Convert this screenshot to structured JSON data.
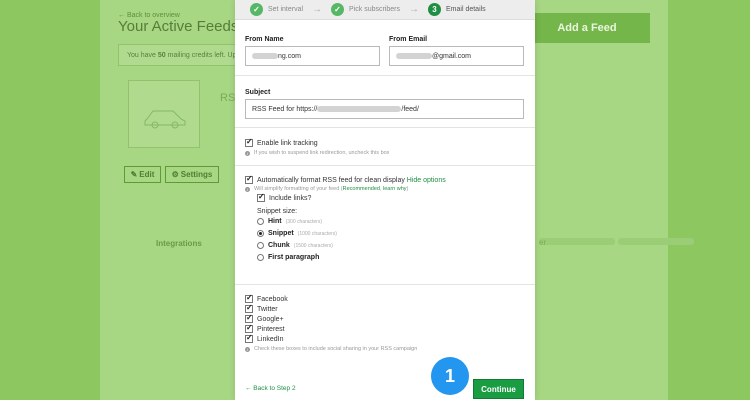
{
  "background": {
    "back_link": "← Back to overview",
    "title": "Your Active Feeds",
    "credits_prefix": "You have ",
    "credits_count": "50",
    "credits_suffix": " mailing credits left. Up",
    "add_feed": "Add a Feed",
    "feed_title_fragment": "RS",
    "edit_label": "Edit",
    "settings_label": "Settings",
    "integrations_label": "Integrations",
    "right_label_fragment": "er"
  },
  "steps": [
    {
      "icon": "✓",
      "label": "Set interval"
    },
    {
      "icon": "✓",
      "label": "Pick subscribers"
    },
    {
      "icon": "3",
      "label": "Email details"
    }
  ],
  "form": {
    "from_name_label": "From Name",
    "from_name_value": "ng.com",
    "from_email_label": "From Email",
    "from_email_value": "@gmail.com",
    "subject_label": "Subject",
    "subject_prefix": "RSS Feed for https://",
    "subject_suffix": "/feed/"
  },
  "link_tracking": {
    "label": "Enable link tracking",
    "hint": "If you wish to suspend link redirection, uncheck this box",
    "checked": true
  },
  "format": {
    "label": "Automatically format RSS feed for clean display ",
    "hide_options": "Hide options",
    "hint_prefix": "Will simplify formatting of your feed (",
    "recommended": "Recommended",
    "sep": ", ",
    "learn_why": "learn why",
    "hint_suffix": ")",
    "include_links": "Include links?",
    "snippet_size_label": "Snippet size:",
    "snippets": [
      {
        "name": "Hint",
        "desc": "(300 characters)",
        "selected": false
      },
      {
        "name": "Snippet",
        "desc": "(1000 characters)",
        "selected": true
      },
      {
        "name": "Chunk",
        "desc": "(1500 characters)",
        "selected": false
      },
      {
        "name": "First paragraph",
        "desc": "",
        "selected": false
      }
    ]
  },
  "social": {
    "items": [
      "Facebook",
      "Twitter",
      "Google+",
      "Pinterest",
      "LinkedIn"
    ],
    "hint": "Check these boxes to include social sharing in your RSS campaign"
  },
  "footer": {
    "back": "← Back to Step 2",
    "continue": "Continue"
  },
  "badge": "1",
  "colors": {
    "page_bg": "#8cc75f",
    "accent_green": "#1a9c43",
    "badge_blue": "#2396ef"
  }
}
